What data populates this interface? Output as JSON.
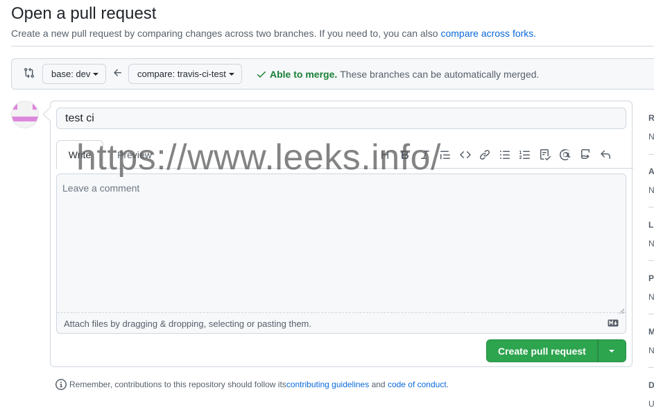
{
  "header": {
    "title": "Open a pull request",
    "subtitle": "Create a new pull request by comparing changes across two branches. If you need to, you can also ",
    "subtitle_link": "compare across forks."
  },
  "range": {
    "base_label": "base: dev",
    "compare_label": "compare: travis-ci-test",
    "merge_ok": "Able to merge.",
    "merge_text": "These branches can be automatically merged."
  },
  "form": {
    "title_value": "test ci",
    "tabs": [
      "Write",
      "Preview"
    ],
    "comment_placeholder": "Leave a comment",
    "attach_text": "Attach files by dragging & dropping, selecting or pasting them.",
    "submit_label": "Create pull request"
  },
  "watermark": "https://www.leeks.info/",
  "footer": {
    "prefix": "Remember, contributions to this repository should follow its ",
    "link1": "contributing guidelines",
    "middle": " and ",
    "link2": "code of conduct",
    "suffix": "."
  },
  "sidebar": {
    "items": [
      {
        "h": "R",
        "v": "N"
      },
      {
        "h": "A",
        "v": "N"
      },
      {
        "h": "L",
        "v": "N"
      },
      {
        "h": "P",
        "v": "N"
      },
      {
        "h": "M",
        "v": "N"
      },
      {
        "h": "D",
        "v": "U"
      }
    ]
  },
  "toolbar_icons": [
    "heading-icon",
    "bold-icon",
    "italic-icon",
    "quote-icon",
    "code-icon",
    "link-icon",
    "unordered-list-icon",
    "ordered-list-icon",
    "task-list-icon",
    "mention-icon",
    "cross-reference-icon",
    "reply-icon"
  ],
  "colors": {
    "accent": "#0969da",
    "success": "#1a7f37",
    "button_green": "#2da44e",
    "border": "#d0d7de"
  }
}
